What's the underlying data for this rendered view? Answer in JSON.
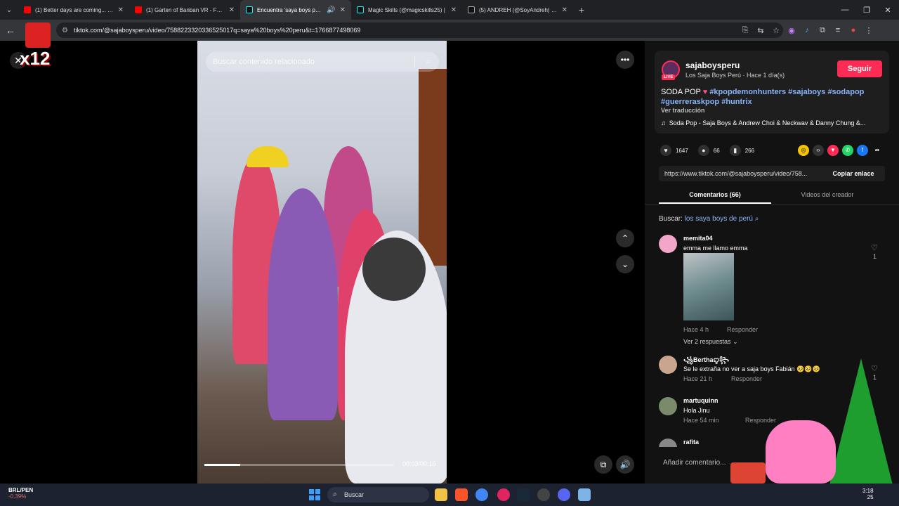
{
  "browser": {
    "tabs": [
      {
        "title": "(1) Better days are coming... The",
        "favicon_color": "#ff0000",
        "active": false
      },
      {
        "title": "(1) Garten of Banban VR - Full G",
        "favicon_color": "#ff0000",
        "active": false
      },
      {
        "title": "Encuentra 'saya boys peru' -",
        "favicon_color": "#111111",
        "active": true
      },
      {
        "title": "Magic Skills (@magicskills25) |",
        "favicon_color": "#111111",
        "active": false
      },
      {
        "title": "(5) ANDREH (@SoyAndreh) / X",
        "favicon_color": "#111111",
        "active": false
      }
    ],
    "url": "tiktok.com/@sajaboysperu/video/7588223320336525017q=saya%20boys%20peru&t=1766877498069"
  },
  "video": {
    "search_placeholder": "Buscar contenido relacionado",
    "time": "00:03/00:16",
    "progress": 0.19,
    "overlay_text": "x12"
  },
  "post": {
    "username": "sajaboysperu",
    "live_badge": "LIVE",
    "subtitle": "Los Saja Boys Perú · Hace 1 día(s)",
    "follow_label": "Seguir",
    "caption_text": "SODA POP",
    "hashtags": [
      "#kpopdemonhunters",
      "#sajaboys",
      "#sodapop",
      "#guerreraskpop",
      "#huntrix"
    ],
    "translate_label": "Ver traducción",
    "music": "Soda Pop - Saja Boys & Andrew Choi & Neckwav & Danny Chung &...",
    "likes": "1647",
    "comments_count": "66",
    "saves": "266",
    "link": "https://www.tiktok.com/@sajaboysperu/video/758...",
    "copy_label": "Copiar enlace"
  },
  "panel_tabs": {
    "comments": "Comentarios (66)",
    "creator_videos": "Videos del creador"
  },
  "search_related": {
    "prefix": "Buscar:",
    "query": "los saya boys de perú"
  },
  "comments": [
    {
      "user": "memita04",
      "text": "emma me llamo emma",
      "meta": "Hace 4 h",
      "reply": "Responder",
      "likes": "1",
      "replies_label": "Ver 2 respuestas",
      "avatar_color": "#f3a6c8"
    },
    {
      "user": "꧁Berthaꨄ꧂",
      "text": "Se le extraña no ver a saja boys Fabián 🥺🥺🥺",
      "meta": "Hace 21 h",
      "reply": "Responder",
      "likes": "1",
      "avatar_color": "#c9a48f"
    },
    {
      "user": "martuquinn",
      "text": "Hola Jinu",
      "meta": "Hace 54 min",
      "reply": "Responder",
      "avatar_color": "#7a8a6a"
    },
    {
      "user": "rafita",
      "avatar_color": "#888888"
    }
  ],
  "add_comment_placeholder": "Añadir comentario...",
  "taskbar": {
    "ticker_pair": "BRL/PEN",
    "ticker_change": "-0.39%",
    "search_label": "Buscar",
    "time": "3:18",
    "date": "25"
  }
}
